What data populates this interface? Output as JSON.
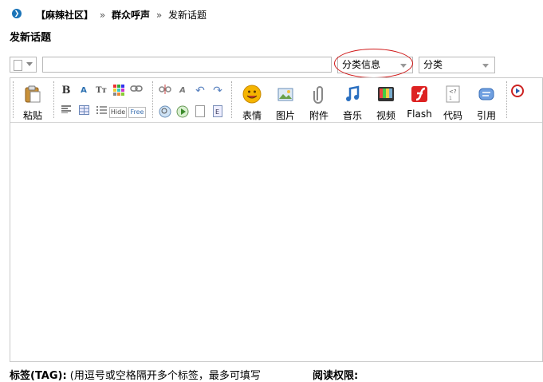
{
  "breadcrumb": {
    "forum": "【麻辣社区】",
    "board": "群众呼声",
    "current": "发新话题",
    "separator": "»"
  },
  "page_title": "发新话题",
  "subject": {
    "value": "",
    "placeholder": ""
  },
  "selects": {
    "class_info": "分类信息",
    "category": "分类"
  },
  "toolbar": {
    "paste": "粘贴",
    "emoticon": "表情",
    "image": "图片",
    "attachment": "附件",
    "music": "音乐",
    "video": "视频",
    "flash": "Flash",
    "code": "代码",
    "quote": "引用",
    "hide_label": "Hide",
    "free_label": "Free"
  },
  "footer": {
    "tag_bold": "标签(TAG):",
    "tag_hint": " (用逗号或空格隔开多个标签，最多可填写",
    "read_perm": "阅读权限:"
  },
  "colors": {
    "highlight_oval": "#d01818",
    "breadcrumb_icon": "#1a74b8"
  }
}
